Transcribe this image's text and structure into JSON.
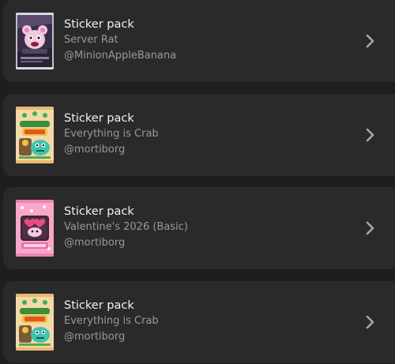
{
  "packs": [
    {
      "title": "Sticker pack",
      "name": "Server Rat",
      "author": "@MinionAppleBanana",
      "icon": "server-rat-pack-art"
    },
    {
      "title": "Sticker pack",
      "name": "Everything is Crab",
      "author": "@mortiborg",
      "icon": "crab-pack-art"
    },
    {
      "title": "Sticker pack",
      "name": "Valentine's 2026 (Basic)",
      "author": "@mortiborg",
      "icon": "valentine-pack-art"
    },
    {
      "title": "Sticker pack",
      "name": "Everything is Crab",
      "author": "@mortiborg",
      "icon": "crab-pack-art"
    }
  ],
  "colors": {
    "background": "#1f1e1e",
    "card": "#2b2a2a",
    "title": "#f2f2f2",
    "subtitle": "#9a9797",
    "chevron": "#a9a6a6"
  }
}
